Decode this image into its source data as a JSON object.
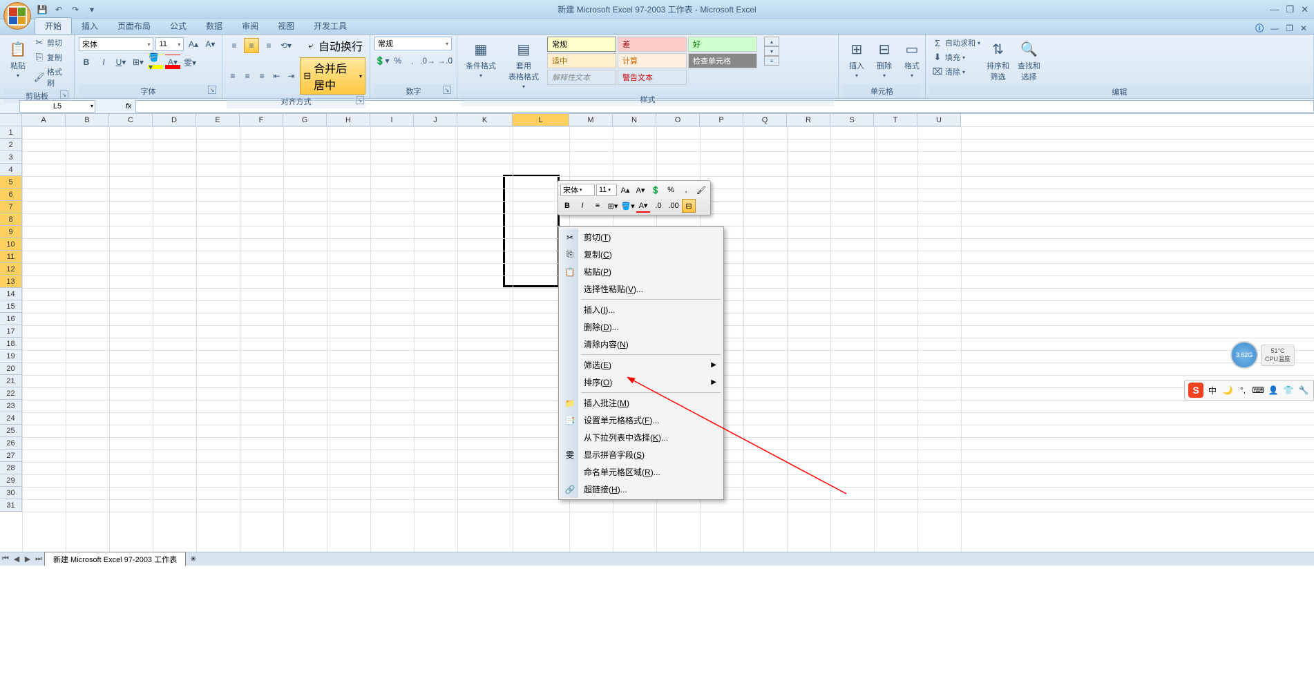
{
  "title": "新建 Microsoft Excel 97-2003 工作表 - Microsoft Excel",
  "tabs": {
    "t0": "开始",
    "t1": "插入",
    "t2": "页面布局",
    "t3": "公式",
    "t4": "数据",
    "t5": "审阅",
    "t6": "视图",
    "t7": "开发工具"
  },
  "clipboard": {
    "paste": "粘贴",
    "cut": "剪切",
    "copy": "复制",
    "painter": "格式刷",
    "label": "剪贴板"
  },
  "font": {
    "name": "宋体",
    "size": "11",
    "label": "字体"
  },
  "align": {
    "wrap": "自动换行",
    "merge": "合并后居中",
    "label": "对齐方式"
  },
  "number": {
    "format": "常规",
    "label": "数字"
  },
  "styles": {
    "cond": "条件格式",
    "table": "套用\n表格格式",
    "s1": "常规",
    "s2": "差",
    "s3": "好",
    "s4": "适中",
    "s5": "计算",
    "s6": "检查单元格",
    "s7": "解释性文本",
    "s8": "警告文本",
    "label": "样式"
  },
  "cells": {
    "insert": "插入",
    "delete": "删除",
    "format": "格式",
    "label": "单元格"
  },
  "editing": {
    "sum": "自动求和",
    "fill": "填充",
    "clear": "清除",
    "sort": "排序和\n筛选",
    "find": "查找和\n选择",
    "label": "编辑"
  },
  "namebox": "L5",
  "cols": [
    "A",
    "B",
    "C",
    "D",
    "E",
    "F",
    "G",
    "H",
    "I",
    "J",
    "K",
    "L",
    "M",
    "N",
    "O",
    "P",
    "Q",
    "R",
    "S",
    "T",
    "U"
  ],
  "rows_count": 31,
  "mini": {
    "font": "宋体",
    "size": "11"
  },
  "ctx": {
    "cut": "剪切",
    "copy": "复制",
    "paste": "粘贴",
    "paste_special": "选择性粘贴",
    "insert": "插入",
    "delete": "删除",
    "clear": "清除内容",
    "filter": "筛选",
    "sort": "排序",
    "comment": "插入批注",
    "format": "设置单元格格式",
    "dropdown": "从下拉列表中选择",
    "phonetic": "显示拼音字段",
    "name_range": "命名单元格区域",
    "hyperlink": "超链接",
    "key": {
      "cut": "T",
      "copy": "C",
      "paste": "P",
      "paste_special": "V",
      "insert": "I",
      "delete": "D",
      "clear": "N",
      "filter": "E",
      "sort": "O",
      "comment": "M",
      "format": "F",
      "dropdown": "K",
      "phonetic": "S",
      "name_range": "R",
      "hyperlink": "H"
    }
  },
  "sheet_tab": "新建 Microsoft Excel 97-2003 工作表",
  "cpu": {
    "val": "3.62G",
    "temp": "51°C",
    "label": "CPU温度"
  },
  "ime_text": "中"
}
